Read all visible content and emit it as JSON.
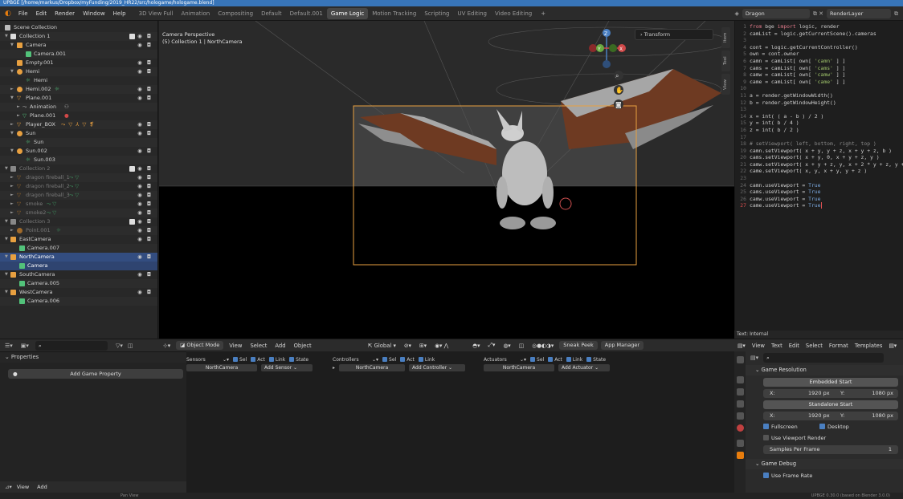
{
  "window": {
    "title": "UPBGE [/home/markus/Dropbox/myFunding/2019_HR22/src/hologame/hologame.blend]"
  },
  "menu": {
    "items": [
      "File",
      "Edit",
      "Render",
      "Window",
      "Help"
    ],
    "workspaces": [
      "3D View Full",
      "Animation",
      "Compositing",
      "Default",
      "Default.001",
      "Game Logic",
      "Motion Tracking",
      "Scripting",
      "UV Editing",
      "Video Editing"
    ],
    "active_workspace": "Game Logic",
    "scene": "Dragon",
    "view_layer": "RenderLayer"
  },
  "outliner": {
    "rows": [
      {
        "label": "Scene Collection"
      },
      {
        "label": "Collection 1"
      },
      {
        "label": "Camera"
      },
      {
        "label": "Camera.001"
      },
      {
        "label": "Empty.001"
      },
      {
        "label": "Hemi"
      },
      {
        "label": "Hemi"
      },
      {
        "label": "Hemi.002"
      },
      {
        "label": "Plane.001"
      },
      {
        "label": "Animation"
      },
      {
        "label": "Plane.001"
      },
      {
        "label": "Player_BOX"
      },
      {
        "label": "Sun"
      },
      {
        "label": "Sun"
      },
      {
        "label": "Sun.002"
      },
      {
        "label": "Sun.003"
      },
      {
        "label": "Collection 2"
      },
      {
        "label": "dragon fireball_1"
      },
      {
        "label": "dragon fireball_2"
      },
      {
        "label": "dragon fireball_3"
      },
      {
        "label": "smoke"
      },
      {
        "label": "smoke2"
      },
      {
        "label": "Collection 3"
      },
      {
        "label": "Point.001"
      },
      {
        "label": "EastCamera"
      },
      {
        "label": "Camera.007"
      },
      {
        "label": "NorthCamera"
      },
      {
        "label": "Camera"
      },
      {
        "label": "SouthCamera"
      },
      {
        "label": "Camera.005"
      },
      {
        "label": "WestCamera"
      },
      {
        "label": "Camera.006"
      }
    ]
  },
  "viewport": {
    "perspective": "Camera Perspective",
    "context": "(5) Collection 1 | NorthCamera",
    "transform_panel": "Transform",
    "side_tabs": [
      "Item",
      "Tool",
      "View"
    ],
    "gizmo_axes": [
      "Z",
      "Y",
      "X"
    ],
    "header": {
      "mode": "Object Mode",
      "menus": [
        "View",
        "Select",
        "Add",
        "Object"
      ],
      "orientation": "Global",
      "buttons": [
        "Sneak Peek",
        "App Manager"
      ]
    }
  },
  "text_editor": {
    "lines": [
      "1  from bge import logic, render",
      "2  camList = logic.getCurrentScene().cameras",
      "3",
      "4  cont = logic.getCurrentController()",
      "5  own = cont.owner",
      "6  camn = camList[ own[ 'camn' ] ]",
      "7  cams = camList[ own[ 'cams' ] ]",
      "8  camw = camList[ own[ 'camw' ] ]",
      "9  came = camList[ own[ 'came' ] ]",
      "10",
      "11 a = render.getWindowWidth()",
      "12 b = render.getWindowHeight()",
      "13",
      "14 x = int( ( a - b ) / 2 )",
      "15 y = int( b / 4 )",
      "16 z = int( b / 2 )",
      "17",
      "18 # setViewport( left, bottom, right, top )",
      "19 camn.setViewport( x + y, y + z, x + y + z, b )",
      "20 cams.setViewport( x + y, 0, x + y + z, y )",
      "21 camw.setViewport( x + y + z, y, x + 2 * y + z, y + z )",
      "22 came.setViewport( x, y, x + y, y + z )",
      "23",
      "24 camn.useViewport = True",
      "25 cams.useViewport = True",
      "26 camw.useViewport = True",
      "27 came.useViewport = True"
    ],
    "footer": "Text: Internal",
    "header_menus": [
      "View",
      "Text",
      "Edit",
      "Select",
      "Format",
      "Templates"
    ]
  },
  "properties": {
    "header": "Properties",
    "add_button": "Add Game Property"
  },
  "logic_bricks": {
    "sensors": {
      "label": "Sensors",
      "object": "NorthCamera",
      "add": "Add Sensor"
    },
    "controllers": {
      "label": "Controllers",
      "object": "NorthCamera",
      "add": "Add Controller"
    },
    "actuators": {
      "label": "Actuators",
      "object": "NorthCamera",
      "add": "Add Actuator"
    },
    "toggles": [
      "Sel",
      "Act",
      "Link",
      "State"
    ]
  },
  "property_editor": {
    "game_resolution": "Game Resolution",
    "embedded_start": "Embedded Start",
    "standalone_start": "Standalone Start",
    "x_label": "X:",
    "y_label": "Y:",
    "res_x": "1920 px",
    "res_y": "1080 px",
    "fullscreen": "Fullscreen",
    "desktop": "Desktop",
    "use_viewport_render": "Use Viewport Render",
    "samples_label": "Samples Per Frame",
    "samples_value": "1",
    "game_debug": "Game Debug",
    "use_frame_rate": "Use Frame Rate"
  },
  "bottom_bar": {
    "view": "View",
    "add": "Add"
  },
  "status": {
    "pan_view": "Pan View",
    "version": "UPBGE 0.30.0 (based on Blender 3.0.0)"
  },
  "colors": {
    "accent_blue": "#4a7fc1",
    "orange": "#e87d0d",
    "selection": "#334d80",
    "title_bar": "#3875b9"
  }
}
